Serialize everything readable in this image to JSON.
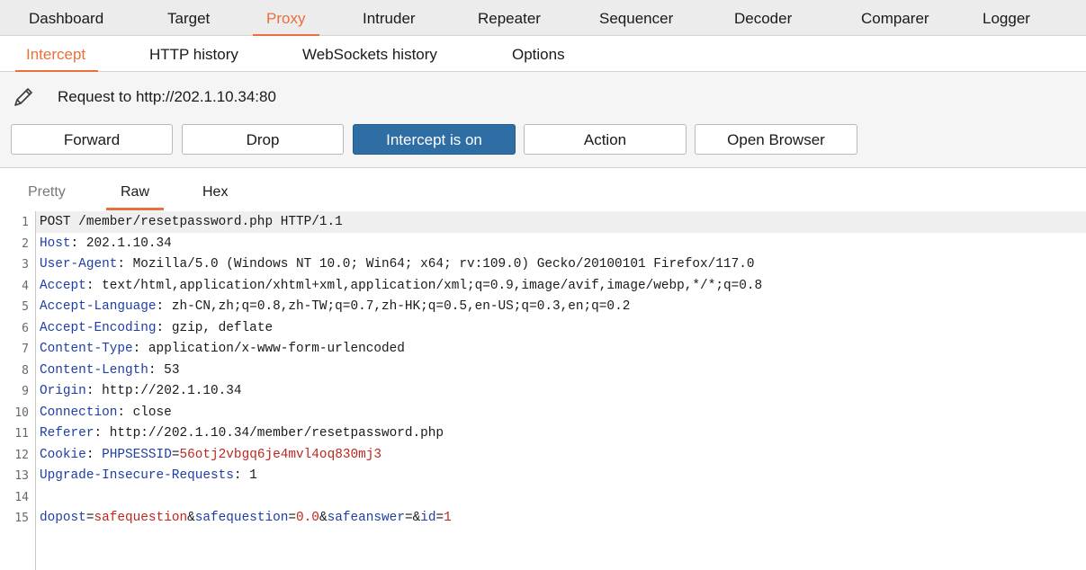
{
  "top_tabs": [
    "Dashboard",
    "Target",
    "Proxy",
    "Intruder",
    "Repeater",
    "Sequencer",
    "Decoder",
    "Comparer",
    "Logger"
  ],
  "sub_tabs": [
    "Intercept",
    "HTTP history",
    "WebSockets history",
    "Options"
  ],
  "request_label": "Request to http://202.1.10.34:80",
  "buttons": {
    "forward": "Forward",
    "drop": "Drop",
    "intercept": "Intercept is on",
    "action": "Action",
    "open_browser": "Open Browser"
  },
  "view_tabs": [
    "Pretty",
    "Raw",
    "Hex"
  ],
  "request_lines": [
    {
      "num": "1",
      "plain": "POST /member/resetpassword.php HTTP/1.1"
    },
    {
      "num": "2",
      "key": "Host",
      "value": " 202.1.10.34"
    },
    {
      "num": "3",
      "key": "User-Agent",
      "value": " Mozilla/5.0 (Windows NT 10.0; Win64; x64; rv:109.0) Gecko/20100101 Firefox/117.0"
    },
    {
      "num": "4",
      "key": "Accept",
      "value": " text/html,application/xhtml+xml,application/xml;q=0.9,image/avif,image/webp,*/*;q=0.8"
    },
    {
      "num": "5",
      "key": "Accept-Language",
      "value": " zh-CN,zh;q=0.8,zh-TW;q=0.7,zh-HK;q=0.5,en-US;q=0.3,en;q=0.2"
    },
    {
      "num": "6",
      "key": "Accept-Encoding",
      "value": " gzip, deflate"
    },
    {
      "num": "7",
      "key": "Content-Type",
      "value": " application/x-www-form-urlencoded"
    },
    {
      "num": "8",
      "key": "Content-Length",
      "value": " 53"
    },
    {
      "num": "9",
      "key": "Origin",
      "value": " http://202.1.10.34"
    },
    {
      "num": "10",
      "key": "Connection",
      "value": " close"
    },
    {
      "num": "11",
      "key": "Referer",
      "value": " http://202.1.10.34/member/resetpassword.php"
    },
    {
      "num": "12",
      "key": "Cookie",
      "cookie_name": "PHPSESSID",
      "cookie_value": "56otj2vbgq6je4mvl4oq830mj3"
    },
    {
      "num": "13",
      "key": "Upgrade-Insecure-Requests",
      "value": " 1"
    },
    {
      "num": "14"
    },
    {
      "num": "15",
      "params": [
        {
          "name": "dopost",
          "value": "safequestion"
        },
        {
          "name": "safequestion",
          "value": "0.0"
        },
        {
          "name": "safeanswer",
          "value": ""
        },
        {
          "name": "id",
          "value": "1"
        }
      ]
    }
  ],
  "colors": {
    "accent": "#e8703a",
    "primary_button": "#2f6ea5",
    "header_key": "#1e3ea3",
    "param_value": "#c0261f"
  }
}
